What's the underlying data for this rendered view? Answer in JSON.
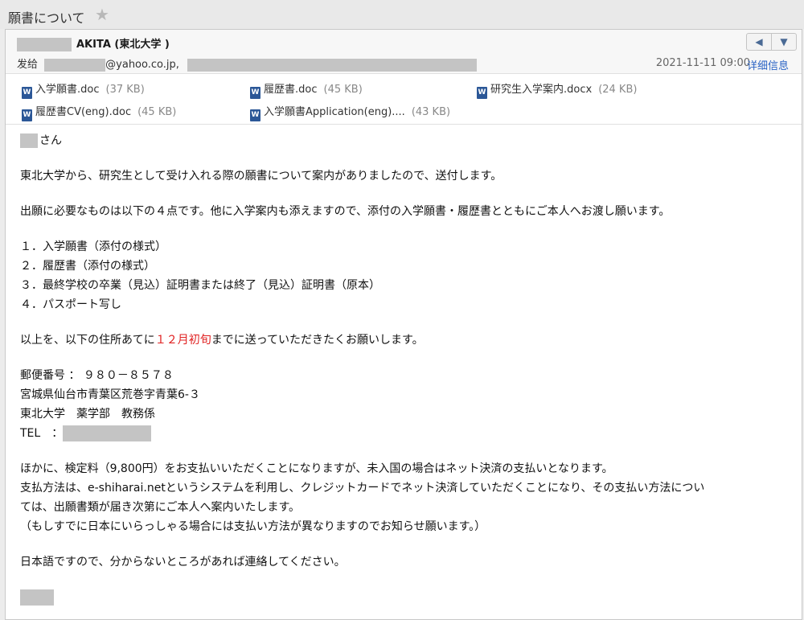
{
  "window": {
    "title": "願書について",
    "star_icon": "star-icon"
  },
  "header": {
    "sender_name": "AKITA (東北大学 )",
    "to_label": "发给",
    "to_address": "@yahoo.co.jp,",
    "datetime": "2021-11-11 09:00",
    "details_link": "详细信息"
  },
  "attachments": [
    {
      "name": "入学願書.doc",
      "size": "(37 KB)"
    },
    {
      "name": "履歴書.doc",
      "size": "(45 KB)"
    },
    {
      "name": "研究生入学案内.docx",
      "size": "(24 KB)"
    },
    {
      "name": "履歴書CV(eng).doc",
      "size": "(45 KB)"
    },
    {
      "name": "入学願書Application(eng)....",
      "size": "(43 KB)"
    }
  ],
  "body": {
    "greeting_suffix": "さん",
    "para1": "東北大学から、研究生として受け入れる際の願書について案内がありましたので、送付します。",
    "para2": "出願に必要なものは以下の４点です。他に入学案内も添えますので、添付の入学願書・履歴書とともにご本人へお渡し願います。",
    "items": [
      "１．入学願書（添付の様式）",
      "２．履歴書（添付の様式）",
      "３．最終学校の卒業（見込）証明書または終了（見込）証明書（原本）",
      "４．パスポート写し"
    ],
    "deadline_pre": "以上を、以下の住所あてに",
    "deadline_highlight": "１２月初旬",
    "deadline_post": "までに送っていただきたくお願いします。",
    "postal": "郵便番号 ： ９８０－８５７８",
    "address": "宮城県仙台市青葉区荒巻字青葉6-３",
    "department": "東北大学　薬学部　教務係",
    "tel_label": "TEL　：",
    "fee1": "ほかに、検定料（9,800円）をお支払いいただくことになりますが、未入国の場合はネット決済の支払いとなります。",
    "fee2": "支払方法は、e-shiharai.netというシステムを利用し、クレジットカードでネット決済していただくことになり、その支払い方法につい",
    "fee3": "ては、出願書類が届き次第にご本人へ案内いたします。",
    "fee4": "（もしすでに日本にいらっしゃる場合には支払い方法が異なりますのでお知らせ願います。）",
    "closing": "日本語ですので、分からないところがあれば連絡してください。"
  }
}
